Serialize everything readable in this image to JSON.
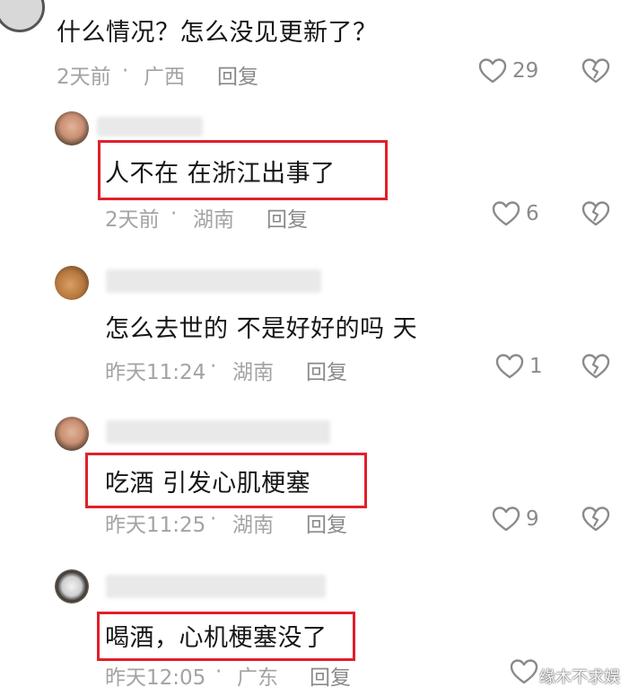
{
  "comments": [
    {
      "text": "什么情况？怎么没见更新了？",
      "time": "2天前",
      "location": "广西",
      "reply": "回复",
      "likes": "29"
    },
    {
      "text": "人不在 在浙江出事了",
      "time": "2天前",
      "location": "湖南",
      "reply": "回复",
      "likes": "6"
    },
    {
      "text": "怎么去世的 不是好好的吗 天",
      "time": "昨天11:24",
      "location": "湖南",
      "reply": "回复",
      "likes": "1"
    },
    {
      "text": "吃酒 引发心肌梗塞",
      "time": "昨天11:25",
      "location": "湖南",
      "reply": "回复",
      "likes": "9"
    },
    {
      "text": "喝酒，心机梗塞没了",
      "time": "昨天12:05",
      "location": "广东",
      "reply": "回复",
      "likes": ""
    }
  ],
  "separator": "·",
  "watermark": "缘木不求娱",
  "colors": {
    "highlight_border": "#e0202a",
    "meta_text": "#a3a3a3",
    "icon_stroke": "#8a8a8a"
  },
  "icons": {
    "like": "heart-icon",
    "dislike": "broken-heart-icon"
  }
}
